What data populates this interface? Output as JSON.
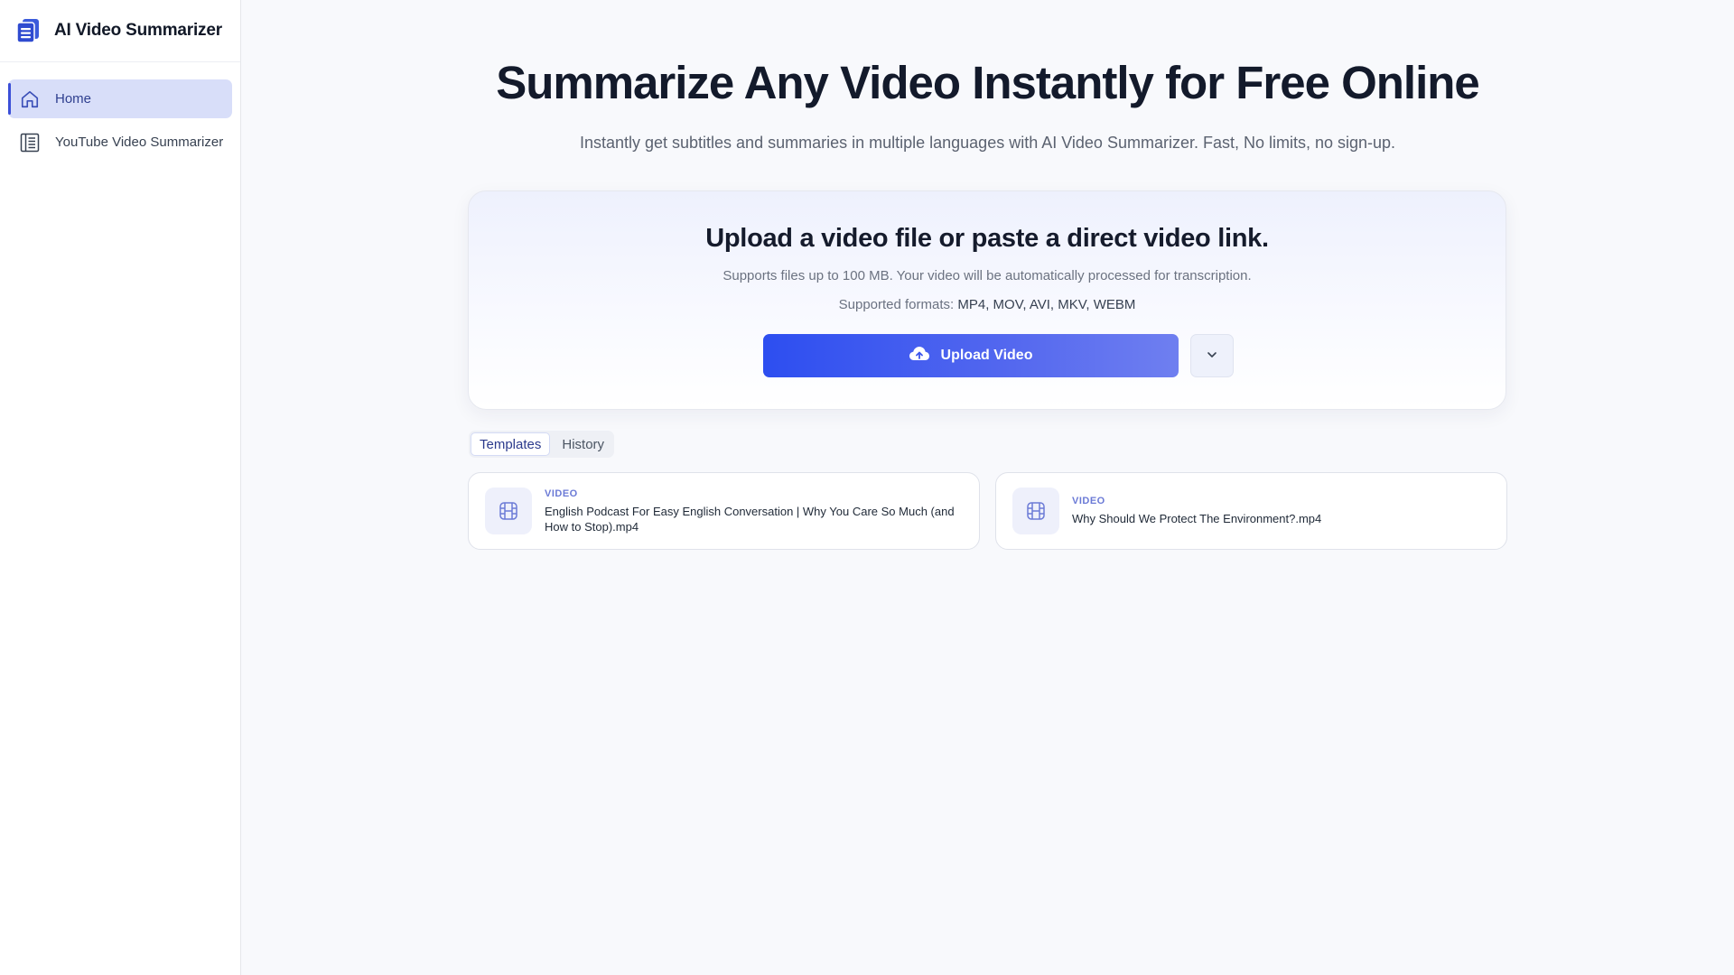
{
  "brand": {
    "title": "AI Video Summarizer"
  },
  "sidebar": {
    "items": [
      {
        "label": "Home",
        "icon": "home-icon",
        "active": true
      },
      {
        "label": "YouTube Video Summarizer",
        "icon": "document-list-icon",
        "active": false
      }
    ]
  },
  "hero": {
    "title": "Summarize Any Video Instantly for Free Online",
    "subtitle": "Instantly get subtitles and summaries in multiple languages with AI Video Summarizer. Fast, No limits, no sign-up."
  },
  "upload": {
    "title": "Upload a video file or paste a direct video link.",
    "description": "Supports files up to 100 MB. Your video will be automatically processed for transcription.",
    "formats_label": "Supported formats:",
    "formats": "MP4, MOV, AVI, MKV, WEBM",
    "button_label": "Upload Video",
    "button_icon": "cloud-upload-icon",
    "dropdown_icon": "chevron-down-icon"
  },
  "tabs": [
    {
      "label": "Templates",
      "active": true
    },
    {
      "label": "History",
      "active": false
    }
  ],
  "items": [
    {
      "type": "VIDEO",
      "name": "English Podcast For Easy English Conversation  |  Why You Care So Much (and How to Stop).mp4",
      "icon": "film-icon"
    },
    {
      "type": "VIDEO",
      "name": "Why Should We Protect The Environment?.mp4",
      "icon": "film-icon"
    }
  ],
  "colors": {
    "accent": "#2d4ef0",
    "active_nav_bg": "#d8def9",
    "page_bg": "#f8f9fc"
  }
}
